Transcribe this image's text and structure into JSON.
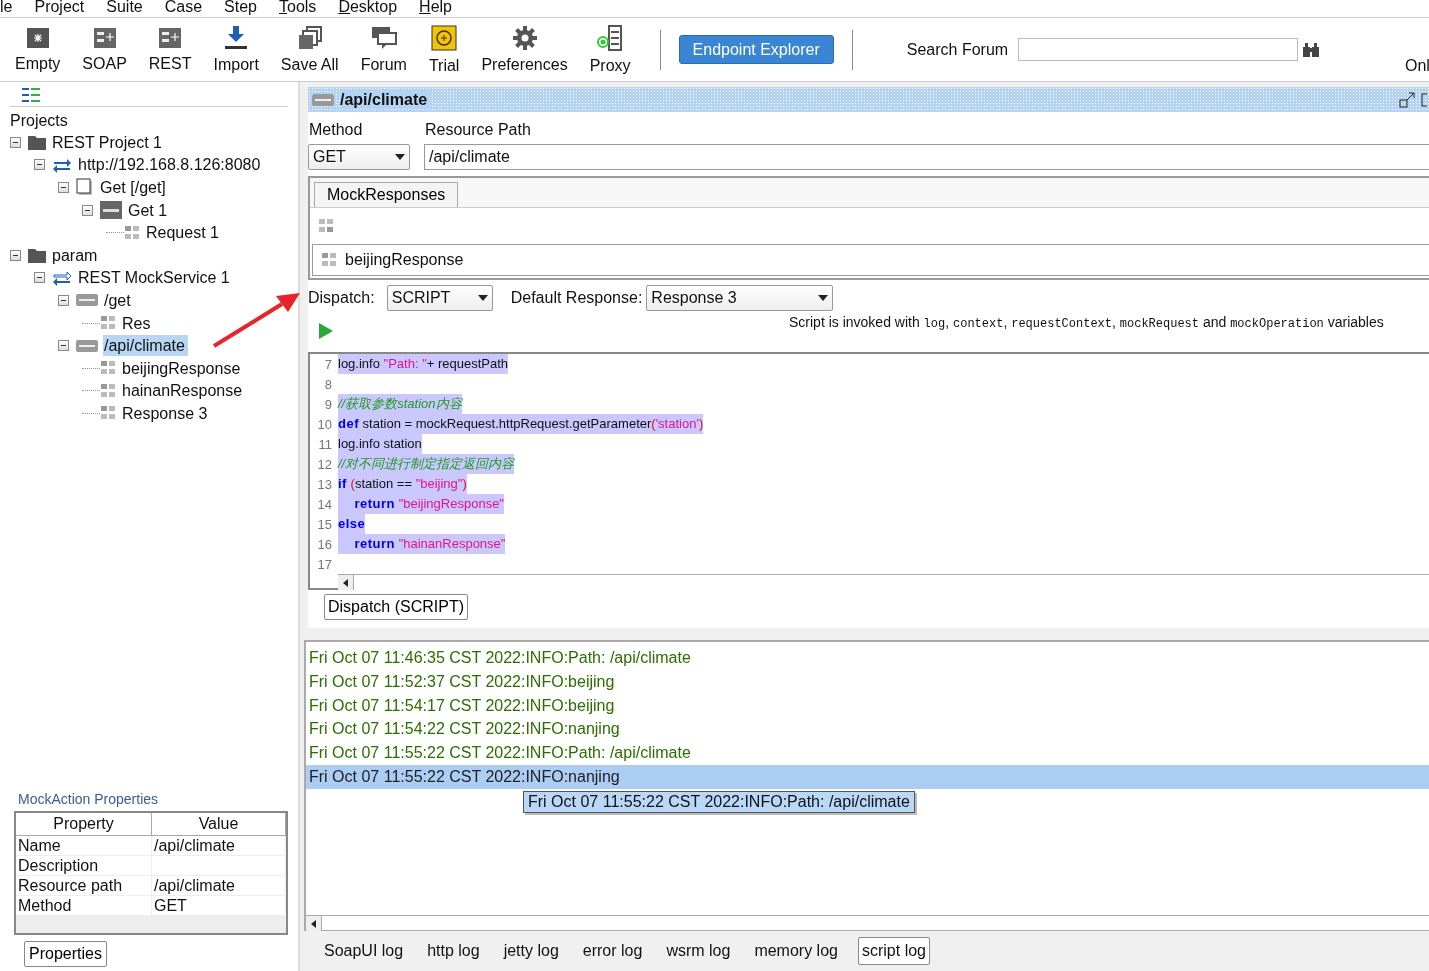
{
  "menu": [
    {
      "label": "le",
      "mnemonic": false
    },
    {
      "label": "Project",
      "mnemonic": false
    },
    {
      "label": "Suite",
      "mnemonic": false
    },
    {
      "label": "Case",
      "mnemonic": false
    },
    {
      "label": "Step",
      "mnemonic": false
    },
    {
      "label": "Tools",
      "mnemonic": true
    },
    {
      "label": "Desktop",
      "mnemonic": true
    },
    {
      "label": "Help",
      "mnemonic": true
    }
  ],
  "toolbar": {
    "tools": [
      {
        "label": "Empty",
        "kind": "empty"
      },
      {
        "label": "SOAP",
        "kind": "soap"
      },
      {
        "label": "REST",
        "kind": "rest"
      },
      {
        "label": "Import",
        "kind": "import"
      },
      {
        "label": "Save All",
        "kind": "saveall"
      },
      {
        "label": "Forum",
        "kind": "forum"
      },
      {
        "label": "Trial",
        "kind": "trial"
      },
      {
        "label": "Preferences",
        "kind": "preferences"
      },
      {
        "label": "Proxy",
        "kind": "proxy"
      }
    ],
    "endpoint_button": "Endpoint Explorer",
    "search_label": "Search Forum",
    "cut_label": "Onl"
  },
  "navigator": {
    "heading": "Projects",
    "tree": [
      {
        "label": "REST Project 1",
        "kind": "project",
        "expanded": true,
        "selected": false,
        "children": [
          {
            "label": "http://192.168.8.126:8080",
            "kind": "interface",
            "expanded": true,
            "selected": false,
            "children": [
              {
                "label": "Get [/get]",
                "kind": "resource",
                "expanded": true,
                "selected": false,
                "children": [
                  {
                    "label": "Get 1",
                    "kind": "method",
                    "expanded": true,
                    "selected": false,
                    "children": [
                      {
                        "label": "Request 1",
                        "kind": "request",
                        "selected": false
                      }
                    ]
                  }
                ]
              }
            ]
          }
        ]
      },
      {
        "label": "param",
        "kind": "project",
        "expanded": true,
        "selected": false,
        "children": [
          {
            "label": "REST MockService 1",
            "kind": "mockservice",
            "expanded": true,
            "selected": false,
            "children": [
              {
                "label": "/get",
                "kind": "action",
                "expanded": true,
                "selected": false,
                "children": [
                  {
                    "label": "Res",
                    "kind": "request",
                    "selected": false
                  }
                ]
              },
              {
                "label": "/api/climate",
                "kind": "action",
                "expanded": true,
                "selected": true,
                "children": [
                  {
                    "label": "beijingResponse",
                    "kind": "request",
                    "selected": false
                  },
                  {
                    "label": "hainanResponse",
                    "kind": "request",
                    "selected": false
                  },
                  {
                    "label": "Response 3",
                    "kind": "request",
                    "selected": false
                  }
                ]
              }
            ]
          }
        ]
      }
    ]
  },
  "properties_panel": {
    "title": "MockAction Properties",
    "columns": [
      "Property",
      "Value"
    ],
    "rows": [
      {
        "property": "Name",
        "value": "/api/climate"
      },
      {
        "property": "Description"
      },
      {
        "property": "Resource path",
        "value": "/api/climate"
      },
      {
        "property": "Method",
        "value": "GET"
      }
    ],
    "button": "Properties"
  },
  "editor": {
    "title": "/api/climate",
    "method_label": "Method",
    "resource_label": "Resource Path",
    "method": "GET",
    "resource_path": "/api/climate",
    "tab": {
      "label": "MockResponses",
      "selected": true
    },
    "responses": [
      "beijingResponse"
    ],
    "dispatch_label": "Dispatch:",
    "dispatch": "SCRIPT",
    "default_label": "Default Response:",
    "default_response": "Response 3",
    "script_info": [
      {
        "text": "Script is invoked with ",
        "code": false
      },
      {
        "text": "log",
        "code": true
      },
      {
        "text": ", ",
        "code": false
      },
      {
        "text": "context",
        "code": true
      },
      {
        "text": ", ",
        "code": false
      },
      {
        "text": "requestContext",
        "code": true
      },
      {
        "text": ", ",
        "code": false
      },
      {
        "text": "mockRequest",
        "code": true
      },
      {
        "text": " and ",
        "code": false
      },
      {
        "text": "mockOperation",
        "code": true
      },
      {
        "text": " variables",
        "code": false
      }
    ],
    "code": [
      {
        "n": "7",
        "selected": true,
        "tokens": [
          {
            "text": "log.info ",
            "kind": "plain"
          },
          {
            "text": "\"Path: \"",
            "kind": "string"
          },
          {
            "text": "+ requestPath",
            "kind": "plain"
          }
        ]
      },
      {
        "n": "8"
      },
      {
        "n": "9",
        "selected": true,
        "tokens": [
          {
            "text": "//获取参数station内容",
            "kind": "comment"
          }
        ]
      },
      {
        "n": "10",
        "selected": true,
        "tokens": [
          {
            "text": "def",
            "kind": "keyword"
          },
          {
            "text": " station = mockRequest.httpRequest.getParameter",
            "kind": "plain"
          },
          {
            "text": "(",
            "kind": "paren"
          },
          {
            "text": "'station'",
            "kind": "string"
          },
          {
            "text": ")",
            "kind": "paren"
          }
        ]
      },
      {
        "n": "11",
        "selected": true,
        "tokens": [
          {
            "text": "log.info station",
            "kind": "plain"
          }
        ]
      },
      {
        "n": "12",
        "selected": true,
        "tokens": [
          {
            "text": "//对不同进行制定指定返回内容",
            "kind": "comment"
          }
        ]
      },
      {
        "n": "13",
        "selected": true,
        "tokens": [
          {
            "text": "if",
            "kind": "keyword"
          },
          {
            "text": " (",
            "kind": "paren"
          },
          {
            "text": "station == ",
            "kind": "plain"
          },
          {
            "text": "\"beijing\"",
            "kind": "string"
          },
          {
            "text": ")",
            "kind": "paren"
          }
        ]
      },
      {
        "n": "14",
        "selected": true,
        "tokens": [
          {
            "text": "    return",
            "kind": "keyword"
          },
          {
            "text": " \"beijingResponse\"",
            "kind": "string"
          }
        ]
      },
      {
        "n": "15",
        "selected": true,
        "tokens": [
          {
            "text": "else",
            "kind": "keyword"
          }
        ]
      },
      {
        "n": "16",
        "selected": true,
        "tokens": [
          {
            "text": "    return",
            "kind": "keyword"
          },
          {
            "text": " \"hainanResponse\"",
            "kind": "string"
          }
        ]
      },
      {
        "n": "17"
      }
    ],
    "dispatch_button": "Dispatch (SCRIPT)"
  },
  "log": {
    "lines": [
      {
        "text": "Fri Oct 07 11:46:35 CST 2022:INFO:Path: /api/climate",
        "selected": false
      },
      {
        "text": "Fri Oct 07 11:52:37 CST 2022:INFO:beijing",
        "selected": false
      },
      {
        "text": "Fri Oct 07 11:54:17 CST 2022:INFO:beijing",
        "selected": false
      },
      {
        "text": "Fri Oct 07 11:54:22 CST 2022:INFO:nanjing",
        "selected": false
      },
      {
        "text": "Fri Oct 07 11:55:22 CST 2022:INFO:Path: /api/climate",
        "selected": false
      },
      {
        "text": "Fri Oct 07 11:55:22 CST 2022:INFO:nanjing",
        "selected": true
      }
    ],
    "tooltip": "Fri Oct 07 11:55:22 CST 2022:INFO:Path: /api/climate",
    "tabs": [
      {
        "label": "SoapUI log",
        "selected": false
      },
      {
        "label": "http log",
        "selected": false
      },
      {
        "label": "jetty log",
        "selected": false
      },
      {
        "label": "error log",
        "selected": false
      },
      {
        "label": "wsrm log",
        "selected": false
      },
      {
        "label": "memory log",
        "selected": false
      },
      {
        "label": "script log",
        "selected": true
      }
    ]
  }
}
